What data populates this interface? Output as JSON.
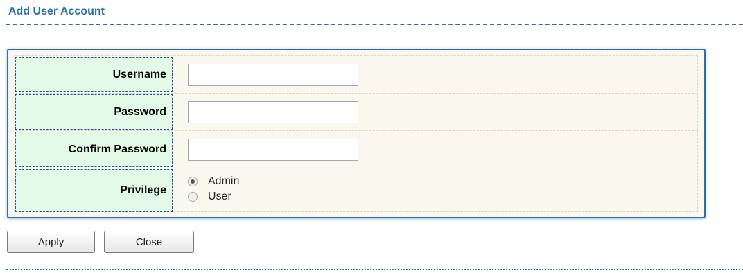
{
  "page": {
    "title": "Add User Account"
  },
  "form": {
    "username": {
      "label": "Username",
      "value": "",
      "placeholder": ""
    },
    "password": {
      "label": "Password",
      "value": "",
      "placeholder": ""
    },
    "confirm_password": {
      "label": "Confirm Password",
      "value": "",
      "placeholder": ""
    },
    "privilege": {
      "label": "Privilege",
      "options": [
        {
          "label": "Admin",
          "selected": true
        },
        {
          "label": "User",
          "selected": false
        }
      ]
    }
  },
  "buttons": {
    "apply_label": "Apply",
    "close_label": "Close"
  },
  "colors": {
    "accent": "#2f6fa8",
    "label_bg": "#e2fae5",
    "panel_bg": "#faf8ee"
  }
}
